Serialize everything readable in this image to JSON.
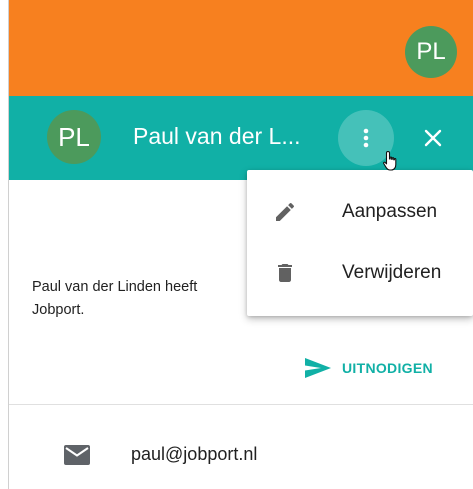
{
  "topbar": {
    "avatar_initials": "PL",
    "color": "#f7801f"
  },
  "header": {
    "avatar_initials": "PL",
    "name": "Paul van der L...",
    "color": "#11b0a6",
    "more_icon": "more-vert-icon",
    "close_icon": "close-icon"
  },
  "menu": {
    "items": [
      {
        "label": "Aanpassen",
        "icon": "pencil-icon"
      },
      {
        "label": "Verwijderen",
        "icon": "trash-icon"
      }
    ]
  },
  "content": {
    "description_line1": "Paul van der Linden heeft",
    "description_line2": "Jobport.",
    "invite_label": "UITNODIGEN",
    "invite_icon": "send-icon",
    "email": "paul@jobport.nl",
    "email_icon": "mail-icon"
  },
  "colors": {
    "accent": "#11b0a6",
    "orange": "#f7801f",
    "avatar": "#4c9a5c"
  }
}
